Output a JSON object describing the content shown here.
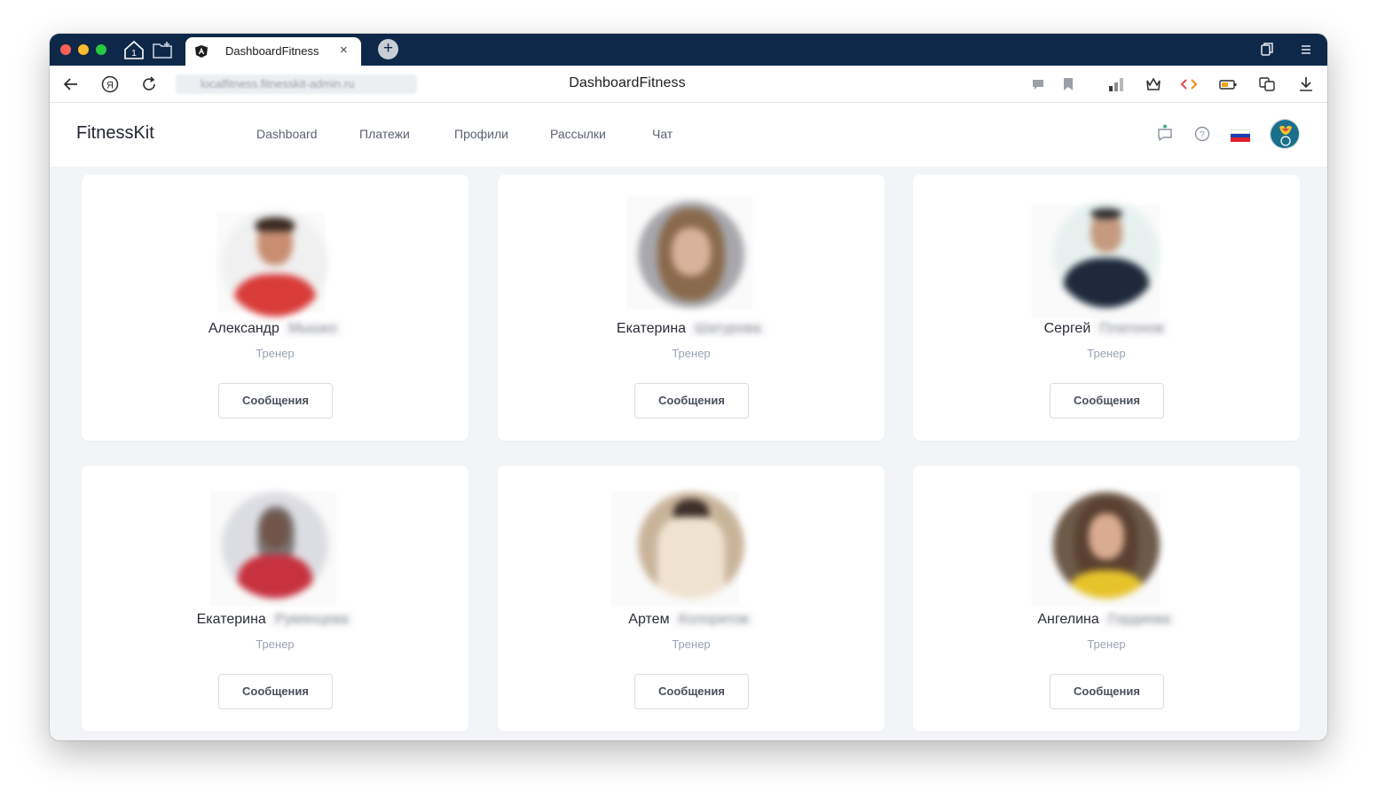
{
  "browser": {
    "tab_title": "DashboardFitness",
    "tab_close": "×",
    "new_tab": "+",
    "url": "localfitness.fitnesskit-admin.ru",
    "page_title": "DashboardFitness",
    "tab_counter": "1"
  },
  "app": {
    "brand": "FitnessKit",
    "nav": [
      {
        "label": "Dashboard"
      },
      {
        "label": "Платежи"
      },
      {
        "label": "Профили"
      },
      {
        "label": "Рассылки"
      },
      {
        "label": "Чат"
      }
    ],
    "colors": {
      "accent": "#0e2849",
      "notification_dot": "#2fb57a"
    }
  },
  "trainers": [
    {
      "first_name": "Александр",
      "surname": "Мышко",
      "role": "Тренер",
      "button": "Сообщения",
      "photo_color": "#d93c3a",
      "photo_bg": "#f2f2f2"
    },
    {
      "first_name": "Екатерина",
      "surname": "Шатурова",
      "role": "Тренер",
      "button": "Сообщения",
      "photo_color": "#8a6a4d",
      "photo_bg": "#9a9aa0"
    },
    {
      "first_name": "Сергей",
      "surname": "Платонов",
      "role": "Тренер",
      "button": "Сообщения",
      "photo_color": "#1e2a3b",
      "photo_bg": "#e6f1ef"
    },
    {
      "first_name": "Екатерина",
      "surname": "Румянцева",
      "role": "Тренер",
      "button": "Сообщения",
      "photo_color": "#c8323f",
      "photo_bg": "#dcdde2"
    },
    {
      "first_name": "Артем",
      "surname": "Колоритов",
      "role": "Тренер",
      "button": "Сообщения",
      "photo_color": "#efe3d0",
      "photo_bg": "#c9b49a"
    },
    {
      "first_name": "Ангелина",
      "surname": "Гордиева",
      "role": "Тренер",
      "button": "Сообщения",
      "photo_color": "#e7c32b",
      "photo_bg": "#6e5a48"
    }
  ]
}
